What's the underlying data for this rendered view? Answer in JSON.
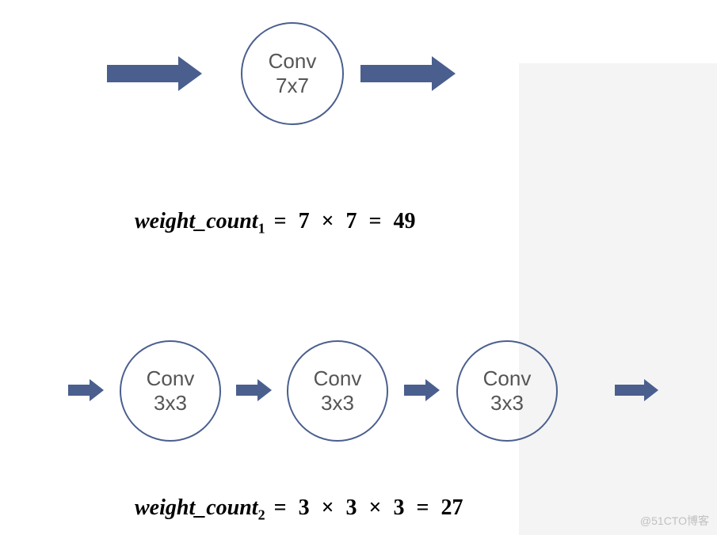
{
  "diagram": {
    "top": {
      "arrow_in": "→",
      "node": {
        "label1": "Conv",
        "label2": "7x7"
      },
      "arrow_out": "→"
    },
    "formula1": {
      "lhs_word": "weight_count",
      "sub": "1",
      "eq1": "=",
      "a": "7",
      "times1": "×",
      "b": "7",
      "eq2": "=",
      "result": "49"
    },
    "bottom": {
      "arrow1": "→",
      "node1": {
        "label1": "Conv",
        "label2": "3x3"
      },
      "arrow2": "→",
      "node2": {
        "label1": "Conv",
        "label2": "3x3"
      },
      "arrow3": "→",
      "node3": {
        "label1": "Conv",
        "label2": "3x3"
      },
      "arrow4": "→"
    },
    "formula2": {
      "lhs_word": "weight_count",
      "sub": "2",
      "eq1": "=",
      "a": "3",
      "times1": "×",
      "b": "3",
      "times2": "×",
      "c": "3",
      "eq2": "=",
      "result": "27"
    }
  },
  "colors": {
    "stroke": "#4a5f8e",
    "gray_bg": "#f4f4f4"
  },
  "watermark": "@51CTO博客",
  "chart_data": {
    "type": "diagram",
    "title": "Convolution weight count comparison",
    "flows": [
      {
        "nodes": [
          "Conv 7x7"
        ],
        "weight_count": 49,
        "calc": "7 × 7 = 49"
      },
      {
        "nodes": [
          "Conv 3x3",
          "Conv 3x3",
          "Conv 3x3"
        ],
        "weight_count": 27,
        "calc": "3 × 3 × 3 = 27"
      }
    ]
  }
}
